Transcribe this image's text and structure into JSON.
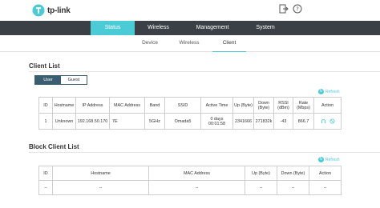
{
  "header": {
    "logo_text": "tp-link",
    "logout_icon": "logout-icon",
    "help_icon": "help-icon"
  },
  "colors": {
    "accent": "#4acbd6",
    "nav_bg": "#3a4046",
    "toggle": "#3a5d72"
  },
  "main_tabs": [
    {
      "label": "Status",
      "active": true
    },
    {
      "label": "Wireless",
      "active": false
    },
    {
      "label": "Management",
      "active": false
    },
    {
      "label": "System",
      "active": false
    }
  ],
  "sub_tabs": [
    {
      "label": "Device",
      "active": false
    },
    {
      "label": "Wireless",
      "active": false
    },
    {
      "label": "Client",
      "active": true
    }
  ],
  "client_list": {
    "title": "Client List",
    "toggle": {
      "user": "User",
      "guest": "Guest"
    },
    "refresh": "Refresh",
    "columns": [
      "ID",
      "Hostname",
      "IP Address",
      "MAC Address",
      "Band",
      "SSID",
      "Active Time",
      "Up (Byte)",
      "Down (Byte)",
      "RSSI (dBm)",
      "Rate (Mbps)",
      "Action"
    ],
    "rows": [
      {
        "id": "1",
        "hostname": "Unknown",
        "ip": "192.168.50.170",
        "mac": "7E",
        "band": "5GHz",
        "ssid": "Omada5",
        "active_time": "0 days 00:01:58",
        "up": "2341666",
        "down": "271832k",
        "rssi": "-43",
        "rate": "866.7"
      }
    ]
  },
  "block_client_list": {
    "title": "Block Client List",
    "refresh": "Refresh",
    "columns": [
      "ID",
      "Hostname",
      "MAC Address",
      "Up (Byte)",
      "Down (Byte)",
      "Action"
    ],
    "rows": [
      {
        "id": "--",
        "hostname": "--",
        "mac": "--",
        "up": "--",
        "down": "--",
        "action": "--"
      }
    ]
  }
}
